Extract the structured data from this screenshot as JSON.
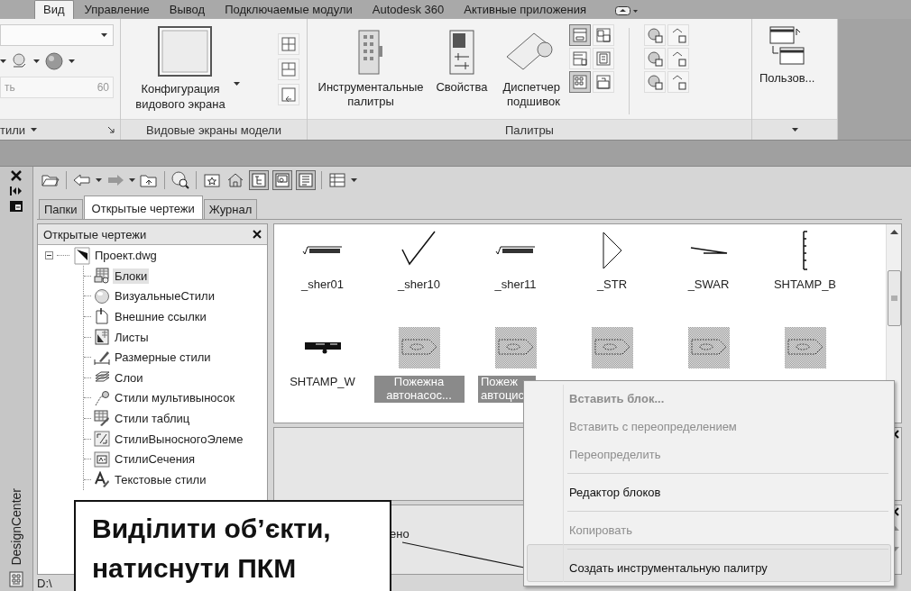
{
  "ribbon": {
    "tabs": [
      {
        "label": "Вид",
        "selected": true
      },
      {
        "label": "Управление",
        "selected": false
      },
      {
        "label": "Вывод",
        "selected": false
      },
      {
        "label": "Подключаемые модули",
        "selected": false
      },
      {
        "label": "Autodesk 360",
        "selected": false
      },
      {
        "label": "Активные приложения",
        "selected": false
      }
    ],
    "styles_panel": {
      "title": "тили",
      "placeholder": "ть",
      "number": "60"
    },
    "viewports_panel": {
      "title": "Видовые экраны модели",
      "button": "Конфигурация видового экрана"
    },
    "palettes_panel": {
      "title": "Палитры",
      "buttons": [
        "Инструментальные палитры",
        "Свойства",
        "Диспетчер подшивок"
      ],
      "toggles": [
        {
          "on": true
        },
        {
          "on": false
        },
        {
          "on": false
        },
        {
          "on": false
        },
        {
          "on": true
        },
        {
          "on": false
        }
      ]
    },
    "interface_panel": {
      "button": "Пользов..."
    }
  },
  "designcenter": {
    "title": "DesignCenter",
    "view_toggles": [
      {
        "on": true
      },
      {
        "on": true
      },
      {
        "on": true
      }
    ],
    "tabs": [
      {
        "label": "Папки",
        "selected": false
      },
      {
        "label": "Открытые чертежи",
        "selected": true
      },
      {
        "label": "Журнал",
        "selected": false
      }
    ],
    "tree": {
      "title": "Открытые чертежи",
      "root": {
        "label": "Проект.dwg",
        "expanded": true,
        "children": [
          {
            "label": "Блоки",
            "kind": "table",
            "selected": true
          },
          {
            "label": "ВизуальныеСтили",
            "kind": "sphere",
            "selected": false
          },
          {
            "label": "Внешние ссылки",
            "kind": "xref",
            "selected": false
          },
          {
            "label": "Листы",
            "kind": "layout",
            "selected": false
          },
          {
            "label": "Размерные стили",
            "kind": "dimstyle",
            "selected": false
          },
          {
            "label": "Слои",
            "kind": "layers",
            "selected": false
          },
          {
            "label": "Стили мультивыносок",
            "kind": "mleader",
            "selected": false
          },
          {
            "label": "Стили таблиц",
            "kind": "tablestyle",
            "selected": false
          },
          {
            "label": "СтилиВыносногоЭлеме",
            "kind": "detailstyle",
            "selected": false
          },
          {
            "label": "СтилиСечения",
            "kind": "sectionstyle",
            "selected": false
          },
          {
            "label": "Текстовые стили",
            "kind": "textstyle",
            "selected": false
          }
        ]
      }
    },
    "blocks": [
      {
        "label": "_sher01",
        "kind": "roughness",
        "selected": false
      },
      {
        "label": "_sher10",
        "kind": "check",
        "selected": false
      },
      {
        "label": "_sher11",
        "kind": "roughness",
        "selected": false
      },
      {
        "label": "_STR",
        "kind": "triangle",
        "selected": false
      },
      {
        "label": "_SWAR",
        "kind": "wedge",
        "selected": false
      },
      {
        "label": "SHTAMP_B",
        "kind": "ruler",
        "selected": false
      },
      {
        "label": "SHTAMP_W",
        "kind": "stamp",
        "selected": false
      },
      {
        "label": "Пожежна автонасос...",
        "kind": "tag",
        "selected": true
      },
      {
        "label": "Пожеж автоцис",
        "kind": "tag",
        "selected": true
      },
      {
        "kind": "tag",
        "selected": true
      },
      {
        "kind": "tag",
        "selected": true
      },
      {
        "kind": "tag",
        "selected": true
      }
    ],
    "description": "ено",
    "status": "D:\\"
  },
  "context_menu": [
    {
      "label": "Вставить блок...",
      "default": true,
      "disabled": true,
      "separator_before": false,
      "selected": false
    },
    {
      "label": "Вставить с переопределением",
      "default": false,
      "disabled": true,
      "separator_before": false,
      "selected": false
    },
    {
      "label": "Переопределить",
      "default": false,
      "disabled": true,
      "separator_before": false,
      "selected": false
    },
    {
      "label": "Редактор блоков",
      "default": false,
      "disabled": false,
      "separator_before": true,
      "selected": false
    },
    {
      "label": "Копировать",
      "default": false,
      "disabled": true,
      "separator_before": true,
      "selected": false
    },
    {
      "label": "Создать инструментальную палитру",
      "default": false,
      "disabled": false,
      "separator_before": true,
      "selected": true
    }
  ],
  "callout": {
    "text": "Виділити об’єкти, натиснути ПКМ"
  }
}
